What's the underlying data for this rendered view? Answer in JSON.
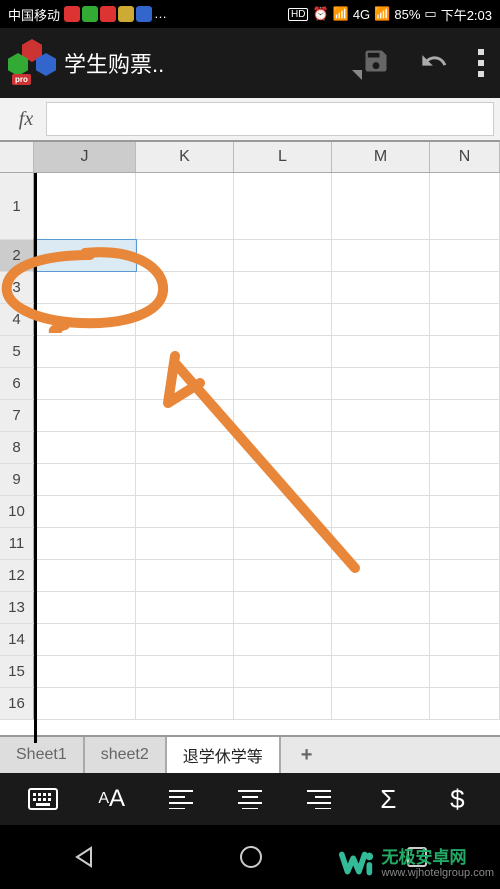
{
  "status": {
    "carrier": "中国移动",
    "hd": "HD",
    "network": "4G",
    "battery": "85%",
    "time": "下午2:03"
  },
  "app": {
    "title": "学生购票..",
    "pro": "pro"
  },
  "formula": {
    "fx": "fx",
    "value": ""
  },
  "columns": [
    "J",
    "K",
    "L",
    "M",
    "N"
  ],
  "rows": [
    "1",
    "2",
    "3",
    "4",
    "5",
    "6",
    "7",
    "8",
    "9",
    "10",
    "11",
    "12",
    "13",
    "14",
    "15",
    "16"
  ],
  "selectedCol": "J",
  "selectedRow": "2",
  "tabs": [
    {
      "label": "Sheet1",
      "active": false
    },
    {
      "label": "sheet2",
      "active": false
    },
    {
      "label": "退学休学等",
      "active": true
    }
  ],
  "addTab": "+",
  "toolbar": {
    "keyboard": "keyboard",
    "font": "AA",
    "alignL": "left",
    "alignC": "center",
    "alignR": "right",
    "sum": "Σ",
    "currency": "$"
  },
  "watermark": {
    "title": "无极安卓网",
    "url": "www.wjhotelgroup.com"
  }
}
